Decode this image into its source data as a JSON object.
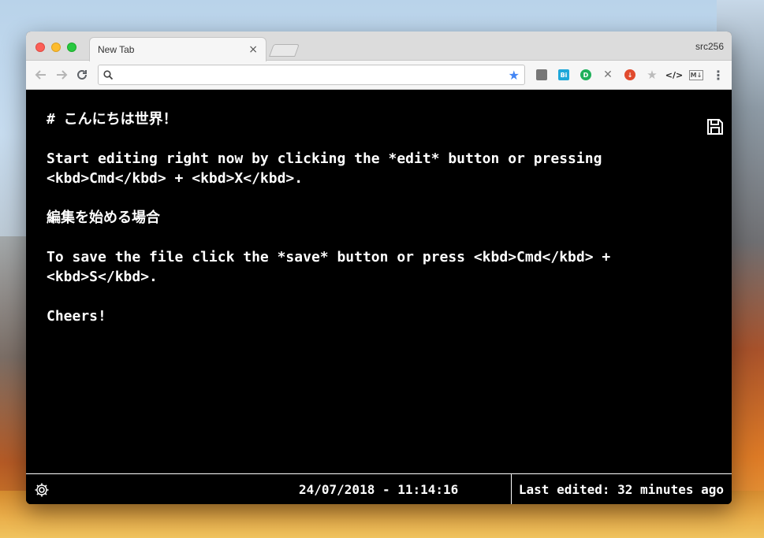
{
  "browser": {
    "tab_title": "New Tab",
    "tab_close": "×",
    "profile_name": "src256",
    "omnibox": {
      "value": "",
      "placeholder": ""
    }
  },
  "extensions": [
    {
      "name": "notes-extension-icon"
    },
    {
      "name": "bi-extension-icon",
      "label": "Bi"
    },
    {
      "name": "d-extension-icon",
      "label": "D"
    },
    {
      "name": "pin-extension-icon"
    },
    {
      "name": "download-extension-icon"
    },
    {
      "name": "star-extension-icon"
    },
    {
      "name": "code-extension-icon",
      "label": "</>"
    },
    {
      "name": "markdown-extension-icon",
      "label": "M↓"
    }
  ],
  "editor": {
    "lines": [
      "# こんにちは世界！",
      "Start editing right now by clicking the *edit* button or pressing\n<kbd>Cmd</kbd> + <kbd>X</kbd>.",
      "編集を始める場合",
      "To save the file click the *save* button or press <kbd>Cmd</kbd> +\n<kbd>S</kbd>.",
      "Cheers!"
    ]
  },
  "status": {
    "datetime": "24/07/2018 - 11:14:16",
    "last_edited": "Last edited: 32 minutes ago"
  },
  "colors": {
    "editor_bg": "#000000",
    "editor_text": "#ffffff",
    "bookmark_star": "#4285f4"
  }
}
